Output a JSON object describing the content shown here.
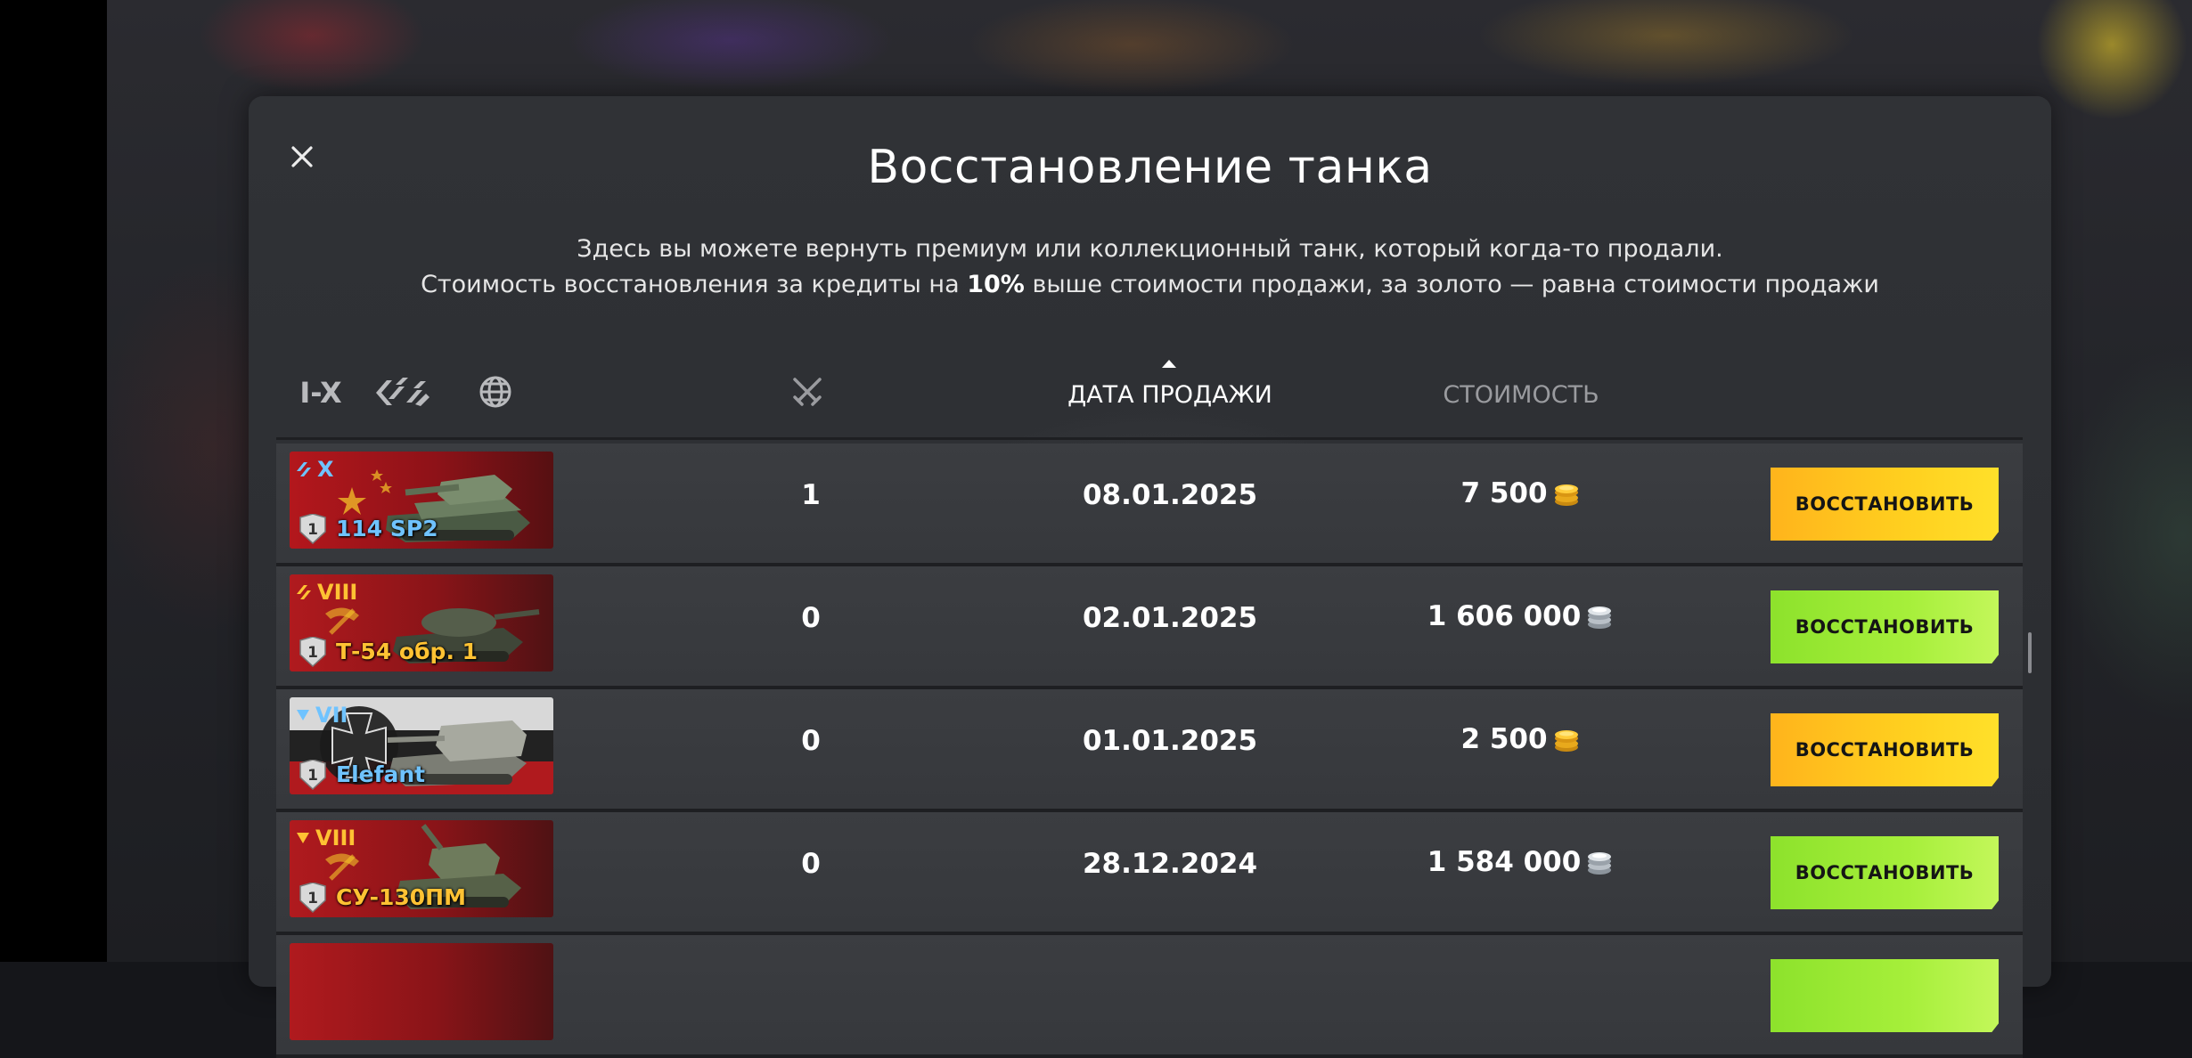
{
  "dialog": {
    "title": "Восстановление танка",
    "subtitle_line1": "Здесь вы можете вернуть премиум или коллекционный танк, который когда-то продали.",
    "subtitle_line2_pre": "Стоимость восстановления за кредиты на ",
    "subtitle_line2_bold": "10%",
    "subtitle_line2_post": " выше стоимости продажи, за золото — равна стоимости продажи",
    "close_icon": "close-icon"
  },
  "header": {
    "filter_tier_label": "I-X",
    "filter_types_icon": "vehicle-types-icon",
    "filter_nations_icon": "globe-icon",
    "battles_icon": "crossed-swords-icon",
    "date_label": "ДАТА ПРОДАЖИ",
    "date_sort": "ascending",
    "cost_label": "СТОИМОСТЬ"
  },
  "rows": [
    {
      "tier": "X",
      "tier_color": "blue",
      "type_icon": "medium-tank-icon",
      "name": "114 SP2",
      "nation": "china",
      "mastery": "1",
      "battles": "1",
      "date": "08.01.2025",
      "cost": "7 500",
      "currency": "gold",
      "button": "ВОССТАНОВИТЬ"
    },
    {
      "tier": "VIII",
      "tier_color": "gold",
      "type_icon": "medium-tank-icon",
      "name": "Т-54 обр. 1",
      "nation": "ussr",
      "mastery": "1",
      "battles": "0",
      "date": "02.01.2025",
      "cost": "1 606 000",
      "currency": "credits",
      "button": "ВОССТАНОВИТЬ"
    },
    {
      "tier": "VII",
      "tier_color": "blue",
      "type_icon": "tank-destroyer-icon",
      "name": "Elefant",
      "nation": "germany",
      "mastery": "1",
      "battles": "0",
      "date": "01.01.2025",
      "cost": "2 500",
      "currency": "gold",
      "button": "ВОССТАНОВИТЬ"
    },
    {
      "tier": "VIII",
      "tier_color": "gold",
      "type_icon": "tank-destroyer-icon",
      "name": "СУ-130ПМ",
      "nation": "ussr",
      "mastery": "1",
      "battles": "0",
      "date": "28.12.2024",
      "cost": "1 584 000",
      "currency": "credits",
      "button": "ВОССТАНОВИТЬ"
    }
  ],
  "colors": {
    "gold_button": "#ffd01f",
    "green_button": "#a6ef3a",
    "tier_blue": "#6fc3ff",
    "tier_gold": "#ffc233"
  }
}
